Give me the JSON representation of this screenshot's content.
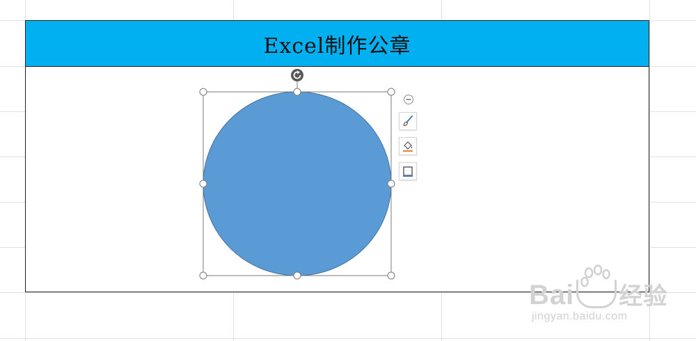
{
  "sheet": {
    "title": "Excel制作公章"
  },
  "shape": {
    "type": "ellipse",
    "fill_color": "#5b9bd5",
    "outline_color": "#41719c",
    "rotate_handle_icon": "rotate-icon"
  },
  "floating_toolbar": {
    "items": [
      {
        "icon": "collapse-minus-icon"
      },
      {
        "icon": "paintbrush-icon"
      },
      {
        "icon": "fill-bucket-icon"
      },
      {
        "icon": "outline-square-icon"
      }
    ]
  },
  "watermark": {
    "logo": "Bai",
    "logo_suffix": "经验",
    "subtext": "jingyan.baidu.com"
  },
  "colors": {
    "title_band": "#00b0f0",
    "gridline": "#e1e1e1"
  }
}
